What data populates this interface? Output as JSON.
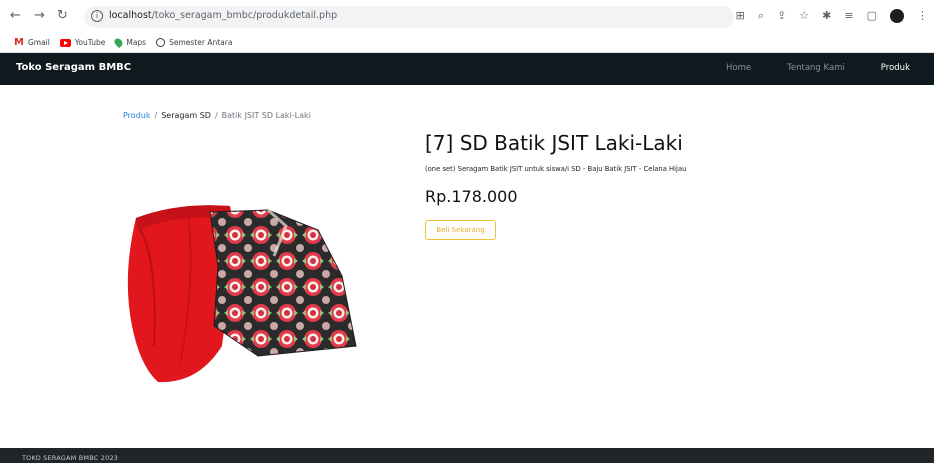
{
  "browser": {
    "url_host": "localhost",
    "url_path": "/toko_seragam_bmbc/produkdetail.php",
    "bookmarks": [
      {
        "label": "Gmail",
        "icon": "gmail-icon"
      },
      {
        "label": "YouTube",
        "icon": "youtube-icon"
      },
      {
        "label": "Maps",
        "icon": "maps-icon"
      },
      {
        "label": "Semester Antara",
        "icon": "globe-icon"
      }
    ]
  },
  "site": {
    "brand": "Toko Seragam BMBC",
    "nav": [
      {
        "label": "Home",
        "active": false
      },
      {
        "label": "Tentang Kami",
        "active": false
      },
      {
        "label": "Produk",
        "active": true
      }
    ]
  },
  "breadcrumb": {
    "root": "Produk",
    "category": "Seragam SD",
    "current": "Batik JSIT SD Laki-Laki"
  },
  "product": {
    "title": "[7] SD Batik JSIT Laki-Laki",
    "description": "(one set) Seragam Batik JSIT untuk siswa/i SD - Baju Batik JSIT - Celana Hijau",
    "price": "Rp.178.000",
    "buy_label": "Beli Sekarang"
  },
  "footer": {
    "text": "TOKO SERAGAM BMBC 2023"
  },
  "colors": {
    "navbar_bg": "#0f1a1f",
    "footer_bg": "#212529",
    "link": "#2f7de1",
    "buy_accent": "#f0c23a"
  }
}
